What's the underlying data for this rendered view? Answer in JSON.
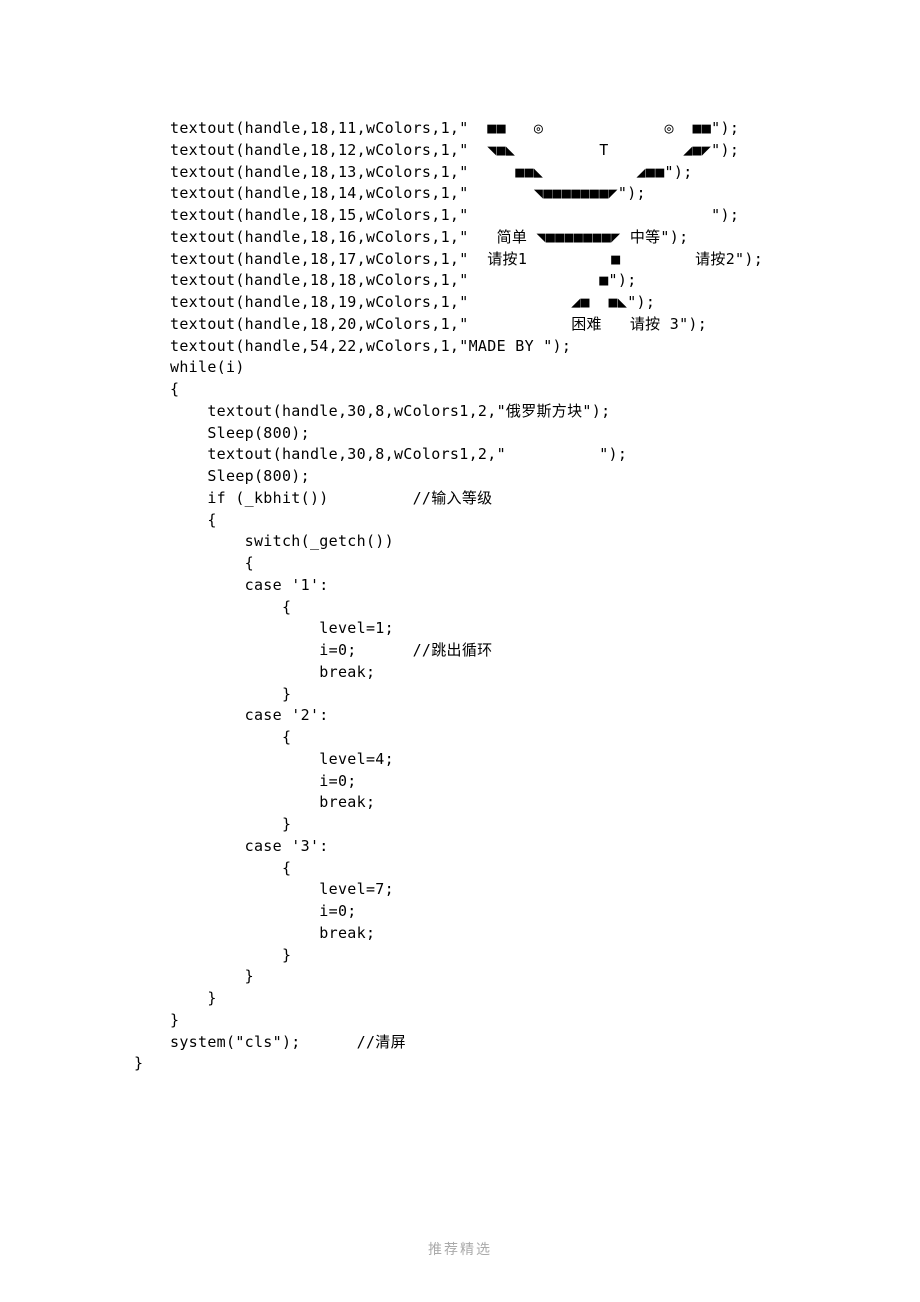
{
  "code": {
    "lines": [
      "textout(handle,18,11,wColors,1,\"  ■■   ◎             ◎  ■■\");",
      "textout(handle,18,12,wColors,1,\"  ◥■◣         T        ◢■◤\");",
      "textout(handle,18,13,wColors,1,\"     ■■◣          ◢■■\");",
      "textout(handle,18,14,wColors,1,\"       ◥■■■■■■■◤\");",
      "textout(handle,18,15,wColors,1,\"                          \");",
      "textout(handle,18,16,wColors,1,\"   简单 ◥■■■■■■■◤ 中等\");",
      "textout(handle,18,17,wColors,1,\"  请按1         ■        请按2\");",
      "textout(handle,18,18,wColors,1,\"              ■\");",
      "textout(handle,18,19,wColors,1,\"           ◢■  ■◣\");",
      "textout(handle,18,20,wColors,1,\"           困难   请按 3\");",
      "textout(handle,54,22,wColors,1,\"MADE BY \");",
      "while(i)",
      "{",
      "    textout(handle,30,8,wColors1,2,\"俄罗斯方块\");",
      "    Sleep(800);",
      "    textout(handle,30,8,wColors1,2,\"          \");",
      "    Sleep(800);",
      "    if (_kbhit())         //输入等级",
      "    {",
      "        switch(_getch())",
      "        {",
      "        case '1':",
      "            {",
      "                level=1;",
      "                i=0;      //跳出循环",
      "                break;",
      "            }",
      "        case '2':",
      "            {",
      "                level=4;",
      "                i=0;",
      "                break;",
      "            }",
      "        case '3':",
      "            {",
      "                level=7;",
      "                i=0;",
      "                break;",
      "            }",
      "        }",
      "    }",
      "}",
      "system(\"cls\");      //清屏"
    ],
    "closing": "}"
  },
  "footer": "推荐精选"
}
